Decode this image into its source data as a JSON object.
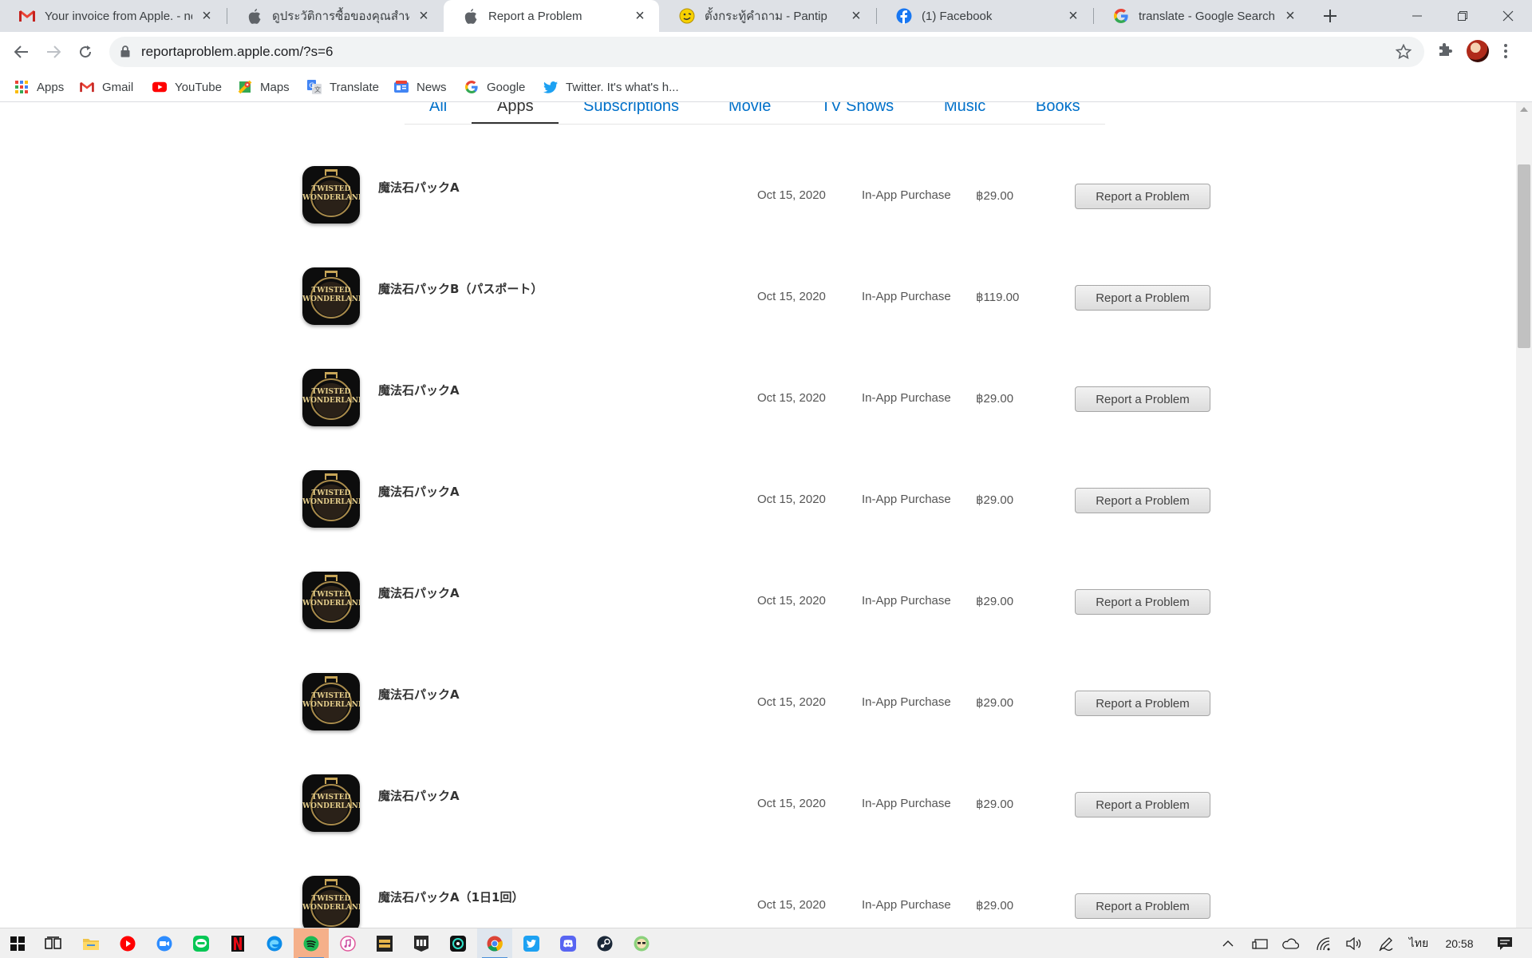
{
  "browser": {
    "tabs": [
      {
        "title": "Your invoice from Apple. - ne",
        "icon": "gmail-icon",
        "active": false
      },
      {
        "title": "ดูประวัติการซื้อของคุณสำหรับ App",
        "icon": "apple-icon",
        "active": false
      },
      {
        "title": "Report a Problem",
        "icon": "apple-icon",
        "active": true
      },
      {
        "title": "ตั้งกระทู้คำถาม - Pantip",
        "icon": "pantip-icon",
        "active": false
      },
      {
        "title": "(1) Facebook",
        "icon": "facebook-icon",
        "active": false
      },
      {
        "title": "translate - Google Search",
        "icon": "google-icon",
        "active": false
      }
    ],
    "url": "reportaproblem.apple.com/?s=6",
    "bookmarks": [
      {
        "label": "Apps",
        "icon": "apps-grid-icon"
      },
      {
        "label": "Gmail",
        "icon": "gmail-icon"
      },
      {
        "label": "YouTube",
        "icon": "youtube-icon"
      },
      {
        "label": "Maps",
        "icon": "maps-icon"
      },
      {
        "label": "Translate",
        "icon": "translate-icon"
      },
      {
        "label": "News",
        "icon": "news-icon"
      },
      {
        "label": "Google",
        "icon": "google-icon"
      },
      {
        "label": "Twitter. It's what's h...",
        "icon": "twitter-icon"
      }
    ]
  },
  "page": {
    "categories": [
      {
        "label": "All",
        "active": false
      },
      {
        "label": "Apps",
        "active": true
      },
      {
        "label": "Subscriptions",
        "active": false
      },
      {
        "label": "Movie",
        "active": false
      },
      {
        "label": "TV Shows",
        "active": false
      },
      {
        "label": "Music",
        "active": false
      },
      {
        "label": "Books",
        "active": false
      }
    ],
    "icon_logo_text": [
      "TWISTED",
      "WONDERLAND"
    ],
    "purchases": [
      {
        "name": "魔法石パックA",
        "date": "Oct 15, 2020",
        "type": "In-App Purchase",
        "price": "฿29.00",
        "button": "Report a Problem"
      },
      {
        "name": "魔法石パックB（パスポート）",
        "date": "Oct 15, 2020",
        "type": "In-App Purchase",
        "price": "฿119.00",
        "button": "Report a Problem"
      },
      {
        "name": "魔法石パックA",
        "date": "Oct 15, 2020",
        "type": "In-App Purchase",
        "price": "฿29.00",
        "button": "Report a Problem"
      },
      {
        "name": "魔法石パックA",
        "date": "Oct 15, 2020",
        "type": "In-App Purchase",
        "price": "฿29.00",
        "button": "Report a Problem"
      },
      {
        "name": "魔法石パックA",
        "date": "Oct 15, 2020",
        "type": "In-App Purchase",
        "price": "฿29.00",
        "button": "Report a Problem"
      },
      {
        "name": "魔法石パックA",
        "date": "Oct 15, 2020",
        "type": "In-App Purchase",
        "price": "฿29.00",
        "button": "Report a Problem"
      },
      {
        "name": "魔法石パックA",
        "date": "Oct 15, 2020",
        "type": "In-App Purchase",
        "price": "฿29.00",
        "button": "Report a Problem"
      },
      {
        "name": "魔法石パックA（1日1回）",
        "date": "Oct 15, 2020",
        "type": "In-App Purchase",
        "price": "฿29.00",
        "button": "Report a Problem"
      }
    ]
  },
  "taskbar": {
    "language": "ไทย",
    "time": "20:58"
  },
  "colors": {
    "link": "#0070c9",
    "tabstrip": "#dee1e6",
    "omnibox": "#f1f3f4"
  }
}
